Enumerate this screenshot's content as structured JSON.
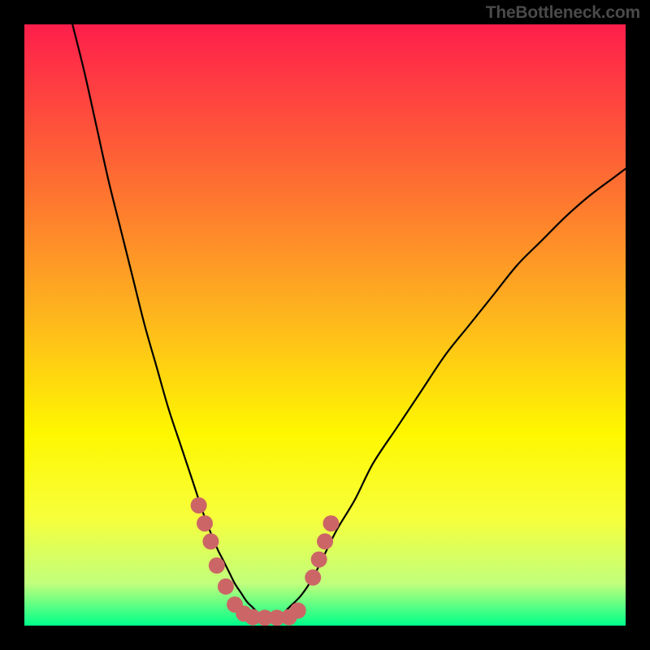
{
  "watermark": "TheBottleneck.com",
  "colors": {
    "frame": "#000000",
    "grad_top": "#fe1e4b",
    "grad_mid1": "#fe6a33",
    "grad_mid2": "#feb41e",
    "grad_mid3": "#fef700",
    "grad_mid4": "#f7ff3b",
    "grad_mid5": "#c1ff7c",
    "grad_bottom": "#00ff8a",
    "curve": "#000000",
    "dot": "#cc6666"
  },
  "chart_data": {
    "type": "line",
    "title": "",
    "xlabel": "",
    "ylabel": "",
    "xlim": [
      0,
      100
    ],
    "ylim": [
      0,
      100
    ],
    "grid": false,
    "series": [
      {
        "name": "bottleneck-curve",
        "x": [
          8,
          10,
          12,
          14,
          16,
          18,
          20,
          22,
          24,
          26,
          28,
          30,
          32,
          33,
          34,
          35,
          36,
          37,
          38,
          39,
          40,
          41,
          42,
          43,
          44,
          46,
          48,
          50,
          52,
          55,
          58,
          62,
          66,
          70,
          74,
          78,
          82,
          86,
          90,
          94,
          98,
          100
        ],
        "y": [
          100,
          92,
          83,
          74,
          66,
          58,
          50,
          43,
          36,
          30,
          24,
          18,
          13,
          11,
          9,
          7,
          5.5,
          4,
          3,
          2,
          1.5,
          1.3,
          1.5,
          2,
          3,
          5,
          8,
          12,
          16,
          21,
          27,
          33,
          39,
          45,
          50,
          55,
          60,
          64,
          68,
          71.5,
          74.5,
          76
        ]
      }
    ],
    "dots": [
      {
        "x": 29,
        "y": 20
      },
      {
        "x": 30,
        "y": 17
      },
      {
        "x": 31,
        "y": 14
      },
      {
        "x": 32,
        "y": 10
      },
      {
        "x": 33.5,
        "y": 6.5
      },
      {
        "x": 35,
        "y": 3.5
      },
      {
        "x": 36.5,
        "y": 2
      },
      {
        "x": 38,
        "y": 1.4
      },
      {
        "x": 40,
        "y": 1.3
      },
      {
        "x": 42,
        "y": 1.3
      },
      {
        "x": 44,
        "y": 1.4
      },
      {
        "x": 45.5,
        "y": 2.5
      },
      {
        "x": 48,
        "y": 8
      },
      {
        "x": 49,
        "y": 11
      },
      {
        "x": 50,
        "y": 14
      },
      {
        "x": 51,
        "y": 17
      }
    ]
  }
}
